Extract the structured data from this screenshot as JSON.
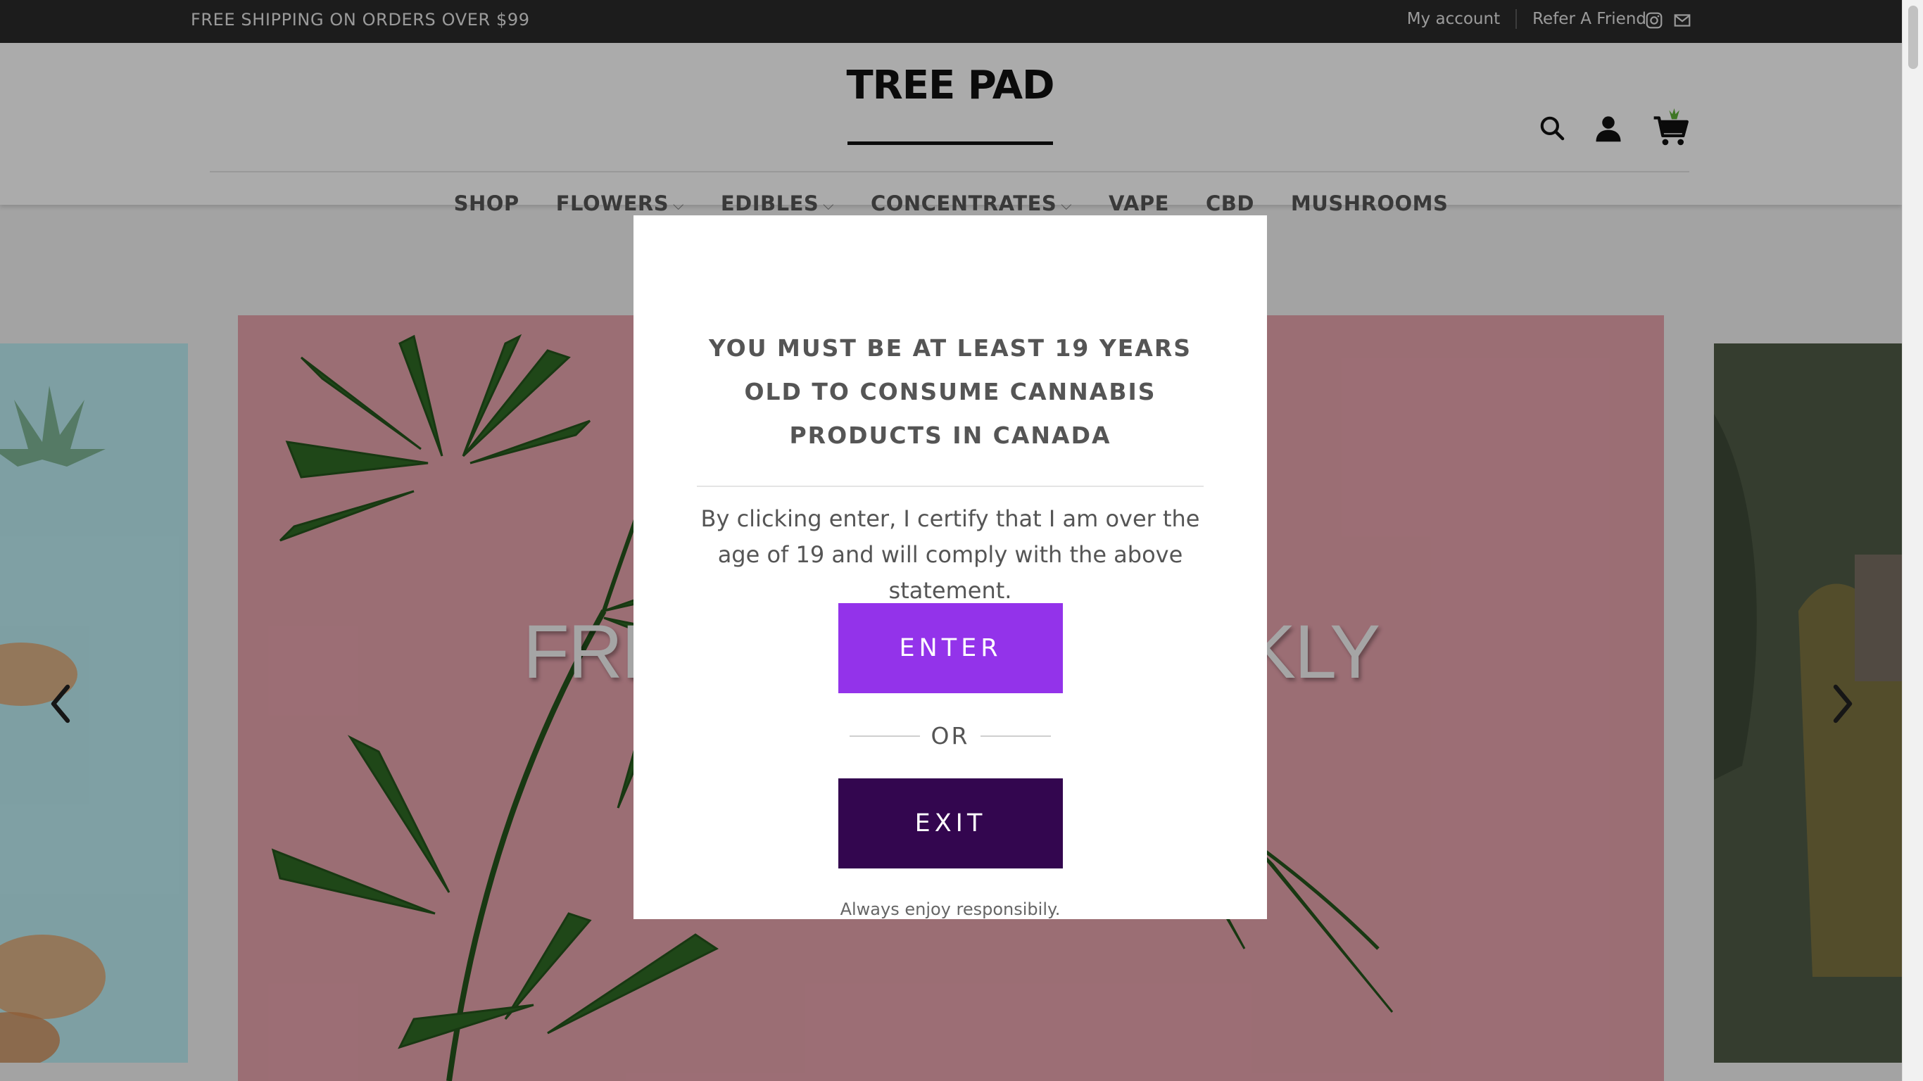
{
  "topbar": {
    "promo": "FREE SHIPPING ON ORDERS OVER $99",
    "my_account": "My account",
    "refer": "Refer A Friend",
    "social_icons": [
      "instagram-icon",
      "email-icon"
    ]
  },
  "header": {
    "logo": "TREE PAD",
    "icons": [
      "search-icon",
      "user-icon",
      "cart-icon"
    ]
  },
  "nav": {
    "items": [
      {
        "label": "SHOP",
        "dropdown": false
      },
      {
        "label": "FLOWERS",
        "dropdown": true
      },
      {
        "label": "EDIBLES",
        "dropdown": true
      },
      {
        "label": "CONCENTRATES",
        "dropdown": true
      },
      {
        "label": "VAPE",
        "dropdown": false
      },
      {
        "label": "CBD",
        "dropdown": false
      },
      {
        "label": "MUSHROOMS",
        "dropdown": false
      }
    ]
  },
  "hero": {
    "caption": "FRESH DROPS WEEKLY",
    "colors": {
      "left": "#bdeef4",
      "main": "#e8a4ae",
      "right": "#5e6a52",
      "leaf": "#3c7a2a"
    }
  },
  "modal": {
    "heading": "YOU MUST BE AT LEAST 19 YEARS OLD TO CONSUME CANNABIS PRODUCTS IN CANADA",
    "body": "By clicking enter, I certify that I am over the age of 19 and will comply with the above statement.",
    "enter_label": "ENTER",
    "or_label": "OR",
    "exit_label": "EXIT",
    "footer": "Always enjoy responsibily.",
    "colors": {
      "enter": "#9333ea",
      "exit": "#33064f"
    }
  }
}
